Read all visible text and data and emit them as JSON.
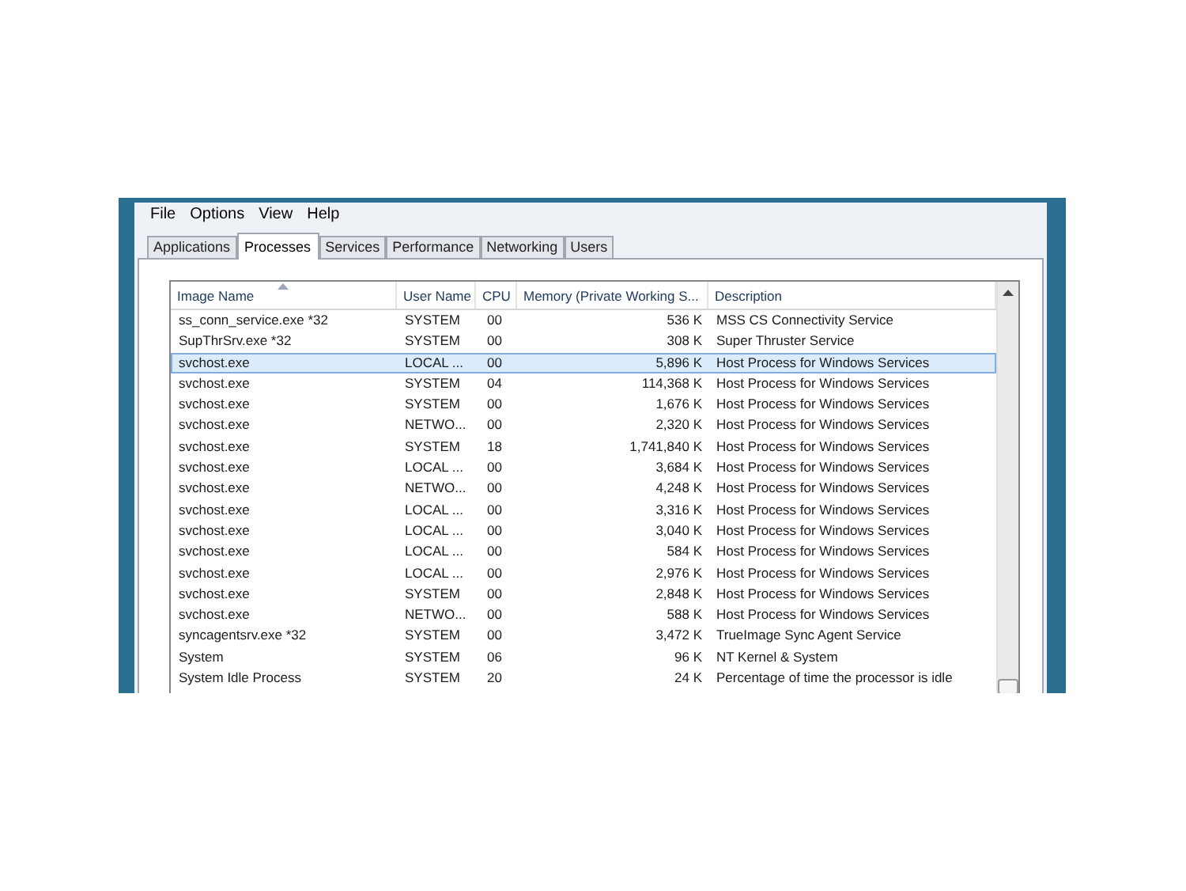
{
  "menu": [
    "File",
    "Options",
    "View",
    "Help"
  ],
  "tabs": [
    {
      "label": "Applications",
      "selected": false
    },
    {
      "label": "Processes",
      "selected": true
    },
    {
      "label": "Services",
      "selected": false
    },
    {
      "label": "Performance",
      "selected": false
    },
    {
      "label": "Networking",
      "selected": false
    },
    {
      "label": "Users",
      "selected": false
    }
  ],
  "table": {
    "columns": [
      {
        "label": "Image Name",
        "sorted": true
      },
      {
        "label": "User Name",
        "sorted": false
      },
      {
        "label": "CPU",
        "sorted": false
      },
      {
        "label": "Memory (Private Working S...",
        "sorted": false
      },
      {
        "label": "Description",
        "sorted": false
      }
    ],
    "rows": [
      {
        "cells": [
          "ss_conn_service.exe *32",
          "SYSTEM",
          "00",
          "536 K",
          "MSS CS Connectivity Service"
        ],
        "selected": false
      },
      {
        "cells": [
          "SupThrSrv.exe *32",
          "SYSTEM",
          "00",
          "308 K",
          "Super Thruster Service"
        ],
        "selected": false
      },
      {
        "cells": [
          "svchost.exe",
          "LOCAL ...",
          "00",
          "5,896 K",
          "Host Process for Windows Services"
        ],
        "selected": true
      },
      {
        "cells": [
          "svchost.exe",
          "SYSTEM",
          "04",
          "114,368 K",
          "Host Process for Windows Services"
        ],
        "selected": false
      },
      {
        "cells": [
          "svchost.exe",
          "SYSTEM",
          "00",
          "1,676 K",
          "Host Process for Windows Services"
        ],
        "selected": false
      },
      {
        "cells": [
          "svchost.exe",
          "NETWO...",
          "00",
          "2,320 K",
          "Host Process for Windows Services"
        ],
        "selected": false
      },
      {
        "cells": [
          "svchost.exe",
          "SYSTEM",
          "18",
          "1,741,840 K",
          "Host Process for Windows Services"
        ],
        "selected": false
      },
      {
        "cells": [
          "svchost.exe",
          "LOCAL ...",
          "00",
          "3,684 K",
          "Host Process for Windows Services"
        ],
        "selected": false
      },
      {
        "cells": [
          "svchost.exe",
          "NETWO...",
          "00",
          "4,248 K",
          "Host Process for Windows Services"
        ],
        "selected": false
      },
      {
        "cells": [
          "svchost.exe",
          "LOCAL ...",
          "00",
          "3,316 K",
          "Host Process for Windows Services"
        ],
        "selected": false
      },
      {
        "cells": [
          "svchost.exe",
          "LOCAL ...",
          "00",
          "3,040 K",
          "Host Process for Windows Services"
        ],
        "selected": false
      },
      {
        "cells": [
          "svchost.exe",
          "LOCAL ...",
          "00",
          "584 K",
          "Host Process for Windows Services"
        ],
        "selected": false
      },
      {
        "cells": [
          "svchost.exe",
          "LOCAL ...",
          "00",
          "2,976 K",
          "Host Process for Windows Services"
        ],
        "selected": false
      },
      {
        "cells": [
          "svchost.exe",
          "SYSTEM",
          "00",
          "2,848 K",
          "Host Process for Windows Services"
        ],
        "selected": false
      },
      {
        "cells": [
          "svchost.exe",
          "NETWO...",
          "00",
          "588 K",
          "Host Process for Windows Services"
        ],
        "selected": false
      },
      {
        "cells": [
          "syncagentsrv.exe *32",
          "SYSTEM",
          "00",
          "3,472 K",
          "TrueImage Sync Agent Service"
        ],
        "selected": false
      },
      {
        "cells": [
          "System",
          "SYSTEM",
          "06",
          "96 K",
          "NT Kernel & System"
        ],
        "selected": false
      },
      {
        "cells": [
          "System Idle Process",
          "SYSTEM",
          "20",
          "24 K",
          "Percentage of time the processor is idle"
        ],
        "selected": false
      }
    ]
  }
}
